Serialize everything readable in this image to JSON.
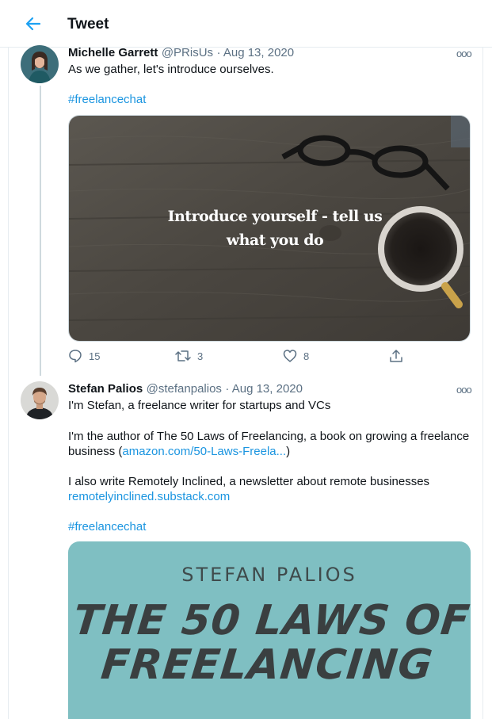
{
  "header": {
    "title": "Tweet"
  },
  "tweet1": {
    "name": "Michelle Garrett",
    "handle": "@PRisUs",
    "date": "· Aug 13, 2020",
    "text": "As we gather, let's introduce ourselves.",
    "hashtag": "#freelancechat",
    "media_text_line1": "Introduce yourself - tell us",
    "media_text_line2": "what you do",
    "replies": "15",
    "retweets": "3",
    "likes": "8"
  },
  "tweet2": {
    "name": "Stefan Palios",
    "handle": "@stefanpalios",
    "date": "· Aug 13, 2020",
    "para1": "I'm Stefan, a freelance writer for startups and VCs",
    "para2_text": "I'm the author of The 50 Laws of Freelancing, a book on growing a freelance business (",
    "para2_link": "amazon.com/50-Laws-Freela...",
    "para2_end": ")",
    "para3_text": "I also write Remotely Inclined, a newsletter about remote businesses",
    "para3_link": "remotelyinclined.substack.com",
    "hashtag": "#freelancechat",
    "media_author": "STEFAN PALIOS",
    "media_title_line1": "THE 50 LAWS OF",
    "media_title_line2": "FREELANCING"
  },
  "more_glyph": "ooo",
  "colors": {
    "link": "#1b95e0",
    "muted": "#5b7083",
    "border": "#e6ecf0",
    "cover_bg": "#7fbfc2"
  }
}
